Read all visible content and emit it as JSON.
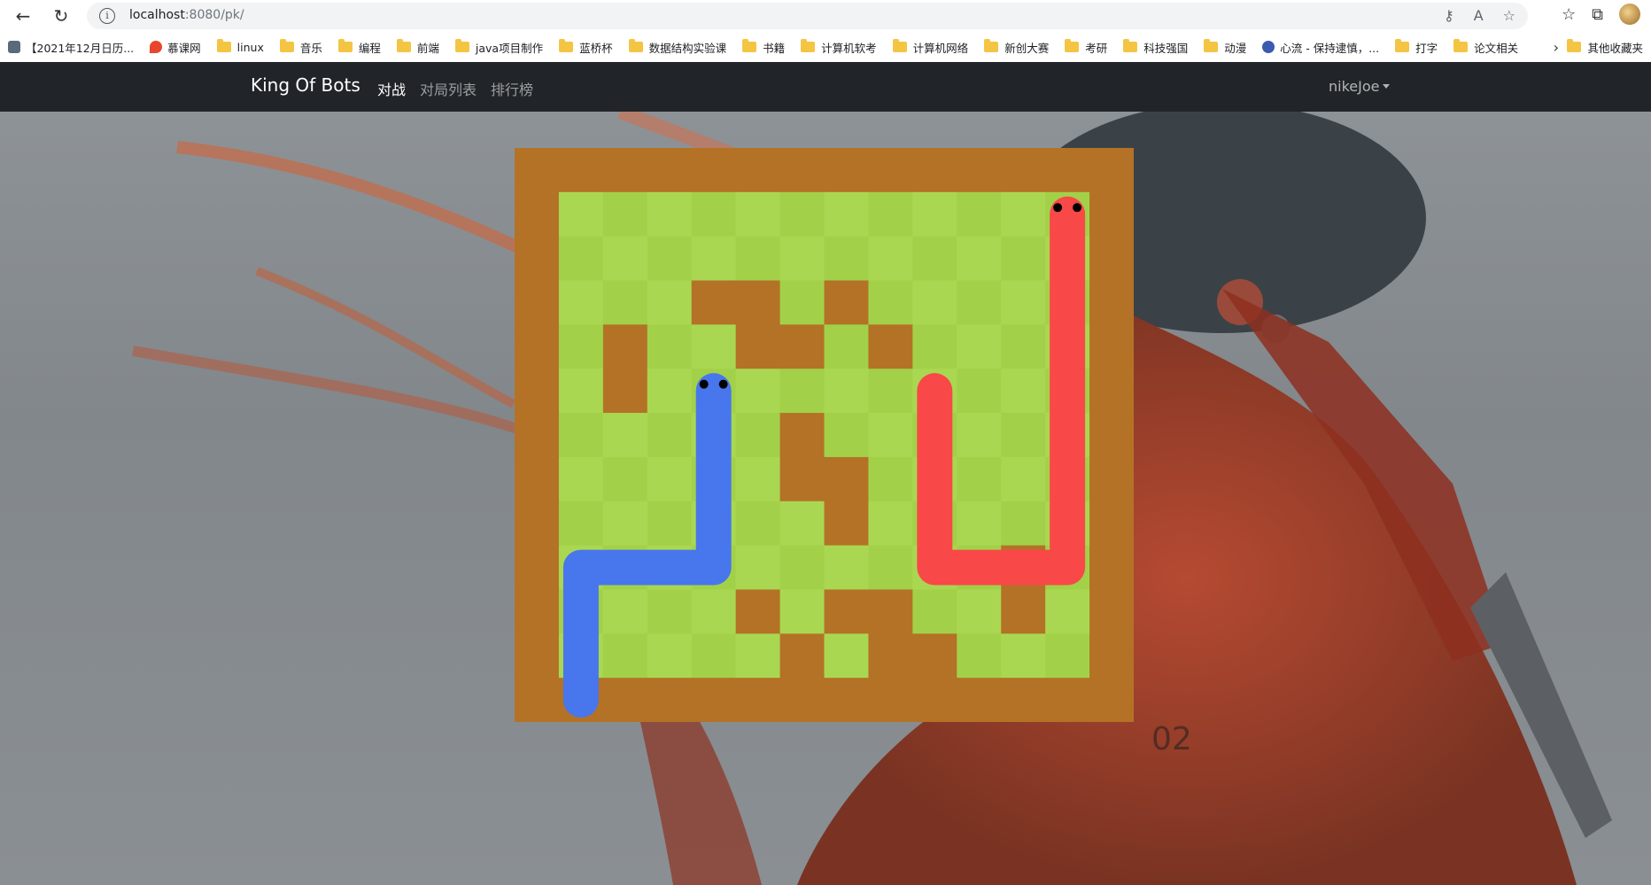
{
  "browser": {
    "url_host": "localhost",
    "url_rest": ":8080/pk/",
    "bookmarks": [
      {
        "label": "【2021年12月日历...",
        "icon": "calendar-icon"
      },
      {
        "label": "慕课网",
        "icon": "flame-icon"
      },
      {
        "label": "linux",
        "icon": "folder-icon"
      },
      {
        "label": "音乐",
        "icon": "folder-icon"
      },
      {
        "label": "编程",
        "icon": "folder-icon"
      },
      {
        "label": "前端",
        "icon": "folder-icon"
      },
      {
        "label": "java项目制作",
        "icon": "folder-icon"
      },
      {
        "label": "蓝桥杯",
        "icon": "folder-icon"
      },
      {
        "label": "数据结构实验课",
        "icon": "folder-icon"
      },
      {
        "label": "书籍",
        "icon": "folder-icon"
      },
      {
        "label": "计算机软考",
        "icon": "folder-icon"
      },
      {
        "label": "计算机网络",
        "icon": "folder-icon"
      },
      {
        "label": "新创大赛",
        "icon": "folder-icon"
      },
      {
        "label": "考研",
        "icon": "folder-icon"
      },
      {
        "label": "科技强国",
        "icon": "folder-icon"
      },
      {
        "label": "动漫",
        "icon": "folder-icon"
      },
      {
        "label": "心流 - 保持逮慎，...",
        "icon": "globe-icon"
      },
      {
        "label": "打字",
        "icon": "folder-icon"
      },
      {
        "label": "论文相关",
        "icon": "folder-icon"
      }
    ],
    "other_bookmarks": "其他收藏夹"
  },
  "navbar": {
    "brand": "King Of Bots",
    "links": [
      {
        "label": "对战",
        "active": true
      },
      {
        "label": "对局列表",
        "active": false
      },
      {
        "label": "排行榜",
        "active": false
      }
    ],
    "user": "nikeJoe"
  },
  "game": {
    "rows": 13,
    "cols": 14,
    "colors": {
      "wall": "#b47226",
      "grass_even": "#aad751",
      "grass_odd": "#a2d149",
      "snake_a": "#4876ec",
      "snake_b": "#f94848"
    },
    "walls": [
      [
        3,
        4
      ],
      [
        3,
        5
      ],
      [
        3,
        7
      ],
      [
        4,
        2
      ],
      [
        4,
        5
      ],
      [
        4,
        6
      ],
      [
        4,
        8
      ],
      [
        5,
        2
      ],
      [
        6,
        6
      ],
      [
        7,
        6
      ],
      [
        7,
        7
      ],
      [
        8,
        7
      ],
      [
        9,
        11
      ],
      [
        10,
        5
      ],
      [
        10,
        7
      ],
      [
        10,
        8
      ],
      [
        10,
        11
      ],
      [
        11,
        6
      ],
      [
        11,
        8
      ],
      [
        11,
        9
      ]
    ],
    "snake_a": [
      [
        12,
        1
      ],
      [
        9,
        1
      ],
      [
        9,
        4
      ],
      [
        5,
        4
      ]
    ],
    "snake_b": [
      [
        5,
        9
      ],
      [
        9,
        9
      ],
      [
        9,
        12
      ],
      [
        1,
        12
      ]
    ]
  }
}
